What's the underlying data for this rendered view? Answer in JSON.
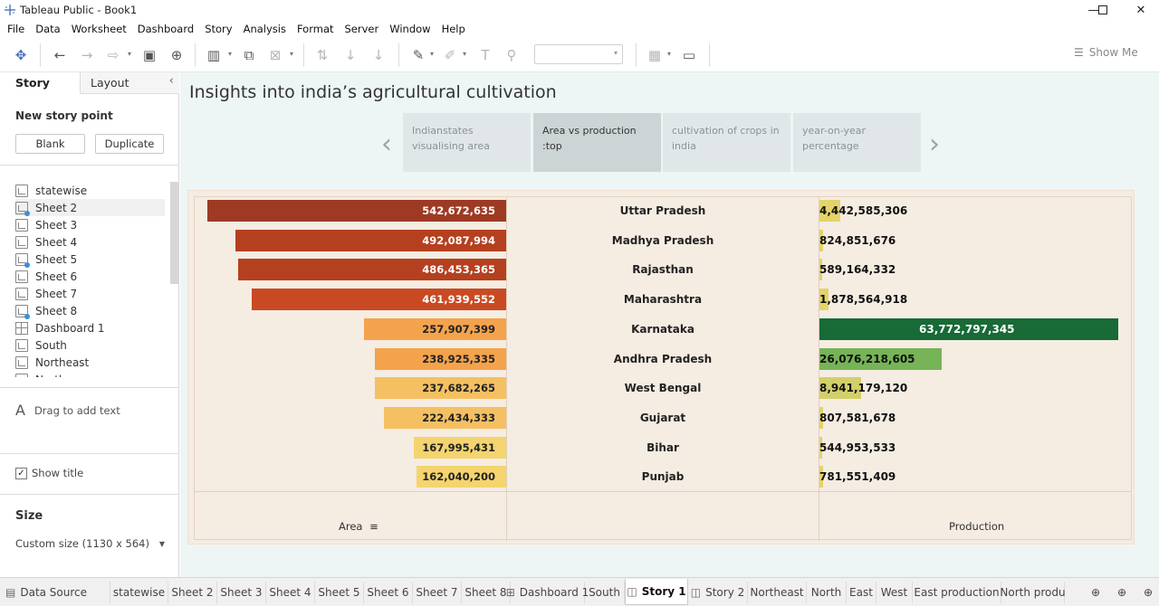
{
  "window": {
    "title": "Tableau Public - Book1",
    "controls": [
      "minimize-icon",
      "restore-icon",
      "close-icon"
    ]
  },
  "menu": [
    "File",
    "Data",
    "Worksheet",
    "Dashboard",
    "Story",
    "Analysis",
    "Format",
    "Server",
    "Window",
    "Help"
  ],
  "toolbar": {
    "show_me": "Show Me"
  },
  "left_panel": {
    "tabs": {
      "story": "Story",
      "layout": "Layout"
    },
    "new_story_point": "New story point",
    "blank_button": "Blank",
    "duplicate_button": "Duplicate",
    "sheets": [
      {
        "name": "statewise",
        "kind": "sheet",
        "used": false
      },
      {
        "name": "Sheet 2",
        "kind": "sheet",
        "used": true
      },
      {
        "name": "Sheet 3",
        "kind": "sheet",
        "used": false
      },
      {
        "name": "Sheet 4",
        "kind": "sheet",
        "used": false
      },
      {
        "name": "Sheet 5",
        "kind": "sheet",
        "used": true
      },
      {
        "name": "Sheet 6",
        "kind": "sheet",
        "used": false
      },
      {
        "name": "Sheet 7",
        "kind": "sheet",
        "used": false
      },
      {
        "name": "Sheet 8",
        "kind": "sheet",
        "used": true
      },
      {
        "name": "Dashboard 1",
        "kind": "dashboard",
        "used": false
      },
      {
        "name": "South",
        "kind": "sheet",
        "used": false
      },
      {
        "name": "Northeast",
        "kind": "sheet",
        "used": false
      },
      {
        "name": "North",
        "kind": "sheet",
        "used": false
      }
    ],
    "drag_text": "Drag to add text",
    "show_title": "Show title",
    "size_heading": "Size",
    "size_value": "Custom size (1130 x 564)"
  },
  "story": {
    "title": "Insights into india’s agricultural cultivation",
    "points": [
      {
        "label": "Indianstates visualising area",
        "active": false
      },
      {
        "label": "Area vs production :top",
        "active": true
      },
      {
        "label": "cultivation of crops in india",
        "active": false
      },
      {
        "label": "year-on-year percentage",
        "active": false
      }
    ]
  },
  "chart_data": {
    "type": "bar",
    "categories": [
      "Uttar Pradesh",
      "Madhya Pradesh",
      "Rajasthan",
      "Maharashtra",
      "Karnataka",
      "Andhra Pradesh",
      "West Bengal",
      "Gujarat",
      "Bihar",
      "Punjab"
    ],
    "series": [
      {
        "name": "Area",
        "values": [
          542672635,
          492087994,
          486453365,
          461939552,
          257907399,
          238925335,
          237682265,
          222434333,
          167995431,
          162040200
        ],
        "labels": [
          "542,672,635",
          "492,087,994",
          "486,453,365",
          "461,939,552",
          "257,907,399",
          "238,925,335",
          "237,682,265",
          "222,434,333",
          "167,995,431",
          "162,040,200"
        ],
        "colors": [
          "#9e3a24",
          "#b5401f",
          "#b5401f",
          "#c94a22",
          "#f4a34d",
          "#f4a34d",
          "#f5c062",
          "#f5c062",
          "#f4d46e",
          "#f4d46e"
        ]
      },
      {
        "name": "Production",
        "values": [
          4442585306,
          824851676,
          589164332,
          1878564918,
          63772797345,
          26076218605,
          8941179120,
          807581678,
          544953533,
          781551409
        ],
        "labels": [
          "4,442,585,306",
          "824,851,676",
          "589,164,332",
          "1,878,564,918",
          "63,772,797,345",
          "26,076,218,605",
          "8,941,179,120",
          "807,581,678",
          "544,953,533",
          "781,551,409"
        ],
        "colors": [
          "#e3d36a",
          "#e3d36a",
          "#e3d36a",
          "#e3d36a",
          "#186a36",
          "#76b457",
          "#d2d06a",
          "#e3d36a",
          "#e3d36a",
          "#e3d36a"
        ]
      }
    ],
    "xlabel_left": "Area",
    "xlabel_right": "Production"
  },
  "bottom_tabs": [
    {
      "label": "Data Source",
      "icon": "database-icon",
      "active": false
    },
    {
      "label": "statewise",
      "active": false
    },
    {
      "label": "Sheet 2",
      "active": false
    },
    {
      "label": "Sheet 3",
      "active": false
    },
    {
      "label": "Sheet 4",
      "active": false
    },
    {
      "label": "Sheet 5",
      "active": false
    },
    {
      "label": "Sheet 6",
      "active": false
    },
    {
      "label": "Sheet 7",
      "active": false
    },
    {
      "label": "Sheet 8",
      "active": false
    },
    {
      "label": "Dashboard 1",
      "icon": "dashboard-icon",
      "active": false
    },
    {
      "label": "South",
      "active": false
    },
    {
      "label": "Story 1",
      "icon": "story-icon",
      "active": true
    },
    {
      "label": "Story 2",
      "icon": "story-icon",
      "active": false
    },
    {
      "label": "Northeast",
      "active": false
    },
    {
      "label": "North",
      "active": false
    },
    {
      "label": "East",
      "active": false
    },
    {
      "label": "West",
      "active": false
    },
    {
      "label": "East production",
      "active": false
    },
    {
      "label": "North produ",
      "active": false
    }
  ]
}
